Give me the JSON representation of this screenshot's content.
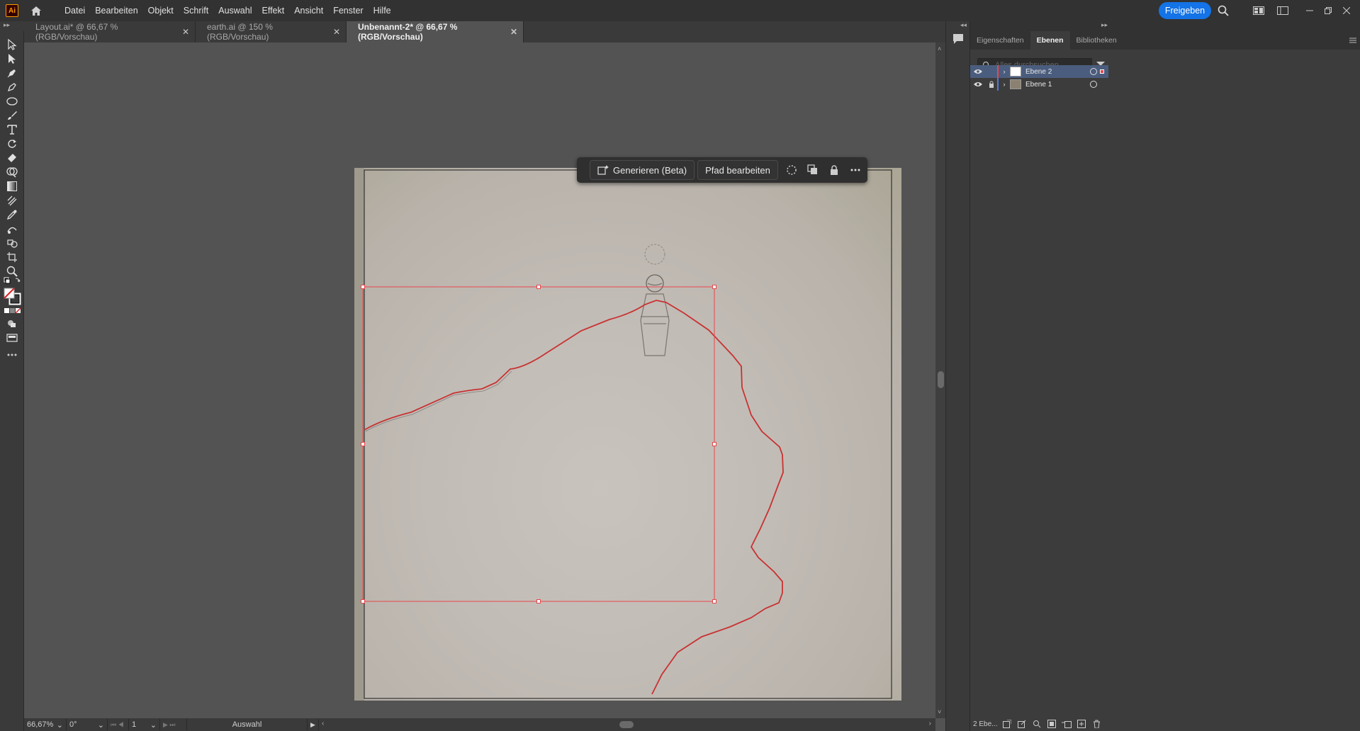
{
  "app": {
    "logo_text": "Ai"
  },
  "menu": [
    "Datei",
    "Bearbeiten",
    "Objekt",
    "Schrift",
    "Auswahl",
    "Effekt",
    "Ansicht",
    "Fenster",
    "Hilfe"
  ],
  "share_label": "Freigeben",
  "tabs": [
    {
      "label": "Layout.ai* @ 66,67 % (RGB/Vorschau)",
      "active": false
    },
    {
      "label": "earth.ai @ 150 % (RGB/Vorschau)",
      "active": false
    },
    {
      "label": "Unbenannt-2* @ 66,67 % (RGB/Vorschau)",
      "active": true
    }
  ],
  "context_bar": {
    "generate_label": "Generieren (Beta)",
    "edit_path_label": "Pfad bearbeiten"
  },
  "panel": {
    "tabs": [
      "Eigenschaften",
      "Ebenen",
      "Bibliotheken"
    ],
    "active_tab": "Ebenen",
    "search_placeholder": "Alles durchsuchen",
    "layers": [
      {
        "name": "Ebene 2",
        "selected": true,
        "locked": false,
        "color": "#e8474c"
      },
      {
        "name": "Ebene 1",
        "selected": false,
        "locked": true,
        "color": "#4f7bd6"
      }
    ],
    "footer_label": "2 Ebe..."
  },
  "status": {
    "zoom": "66,67%",
    "rotation": "0°",
    "artboard_number": "1",
    "tool_label": "Auswahl"
  },
  "colors": {
    "accent": "#1473e6",
    "selection": "#e8474c"
  }
}
